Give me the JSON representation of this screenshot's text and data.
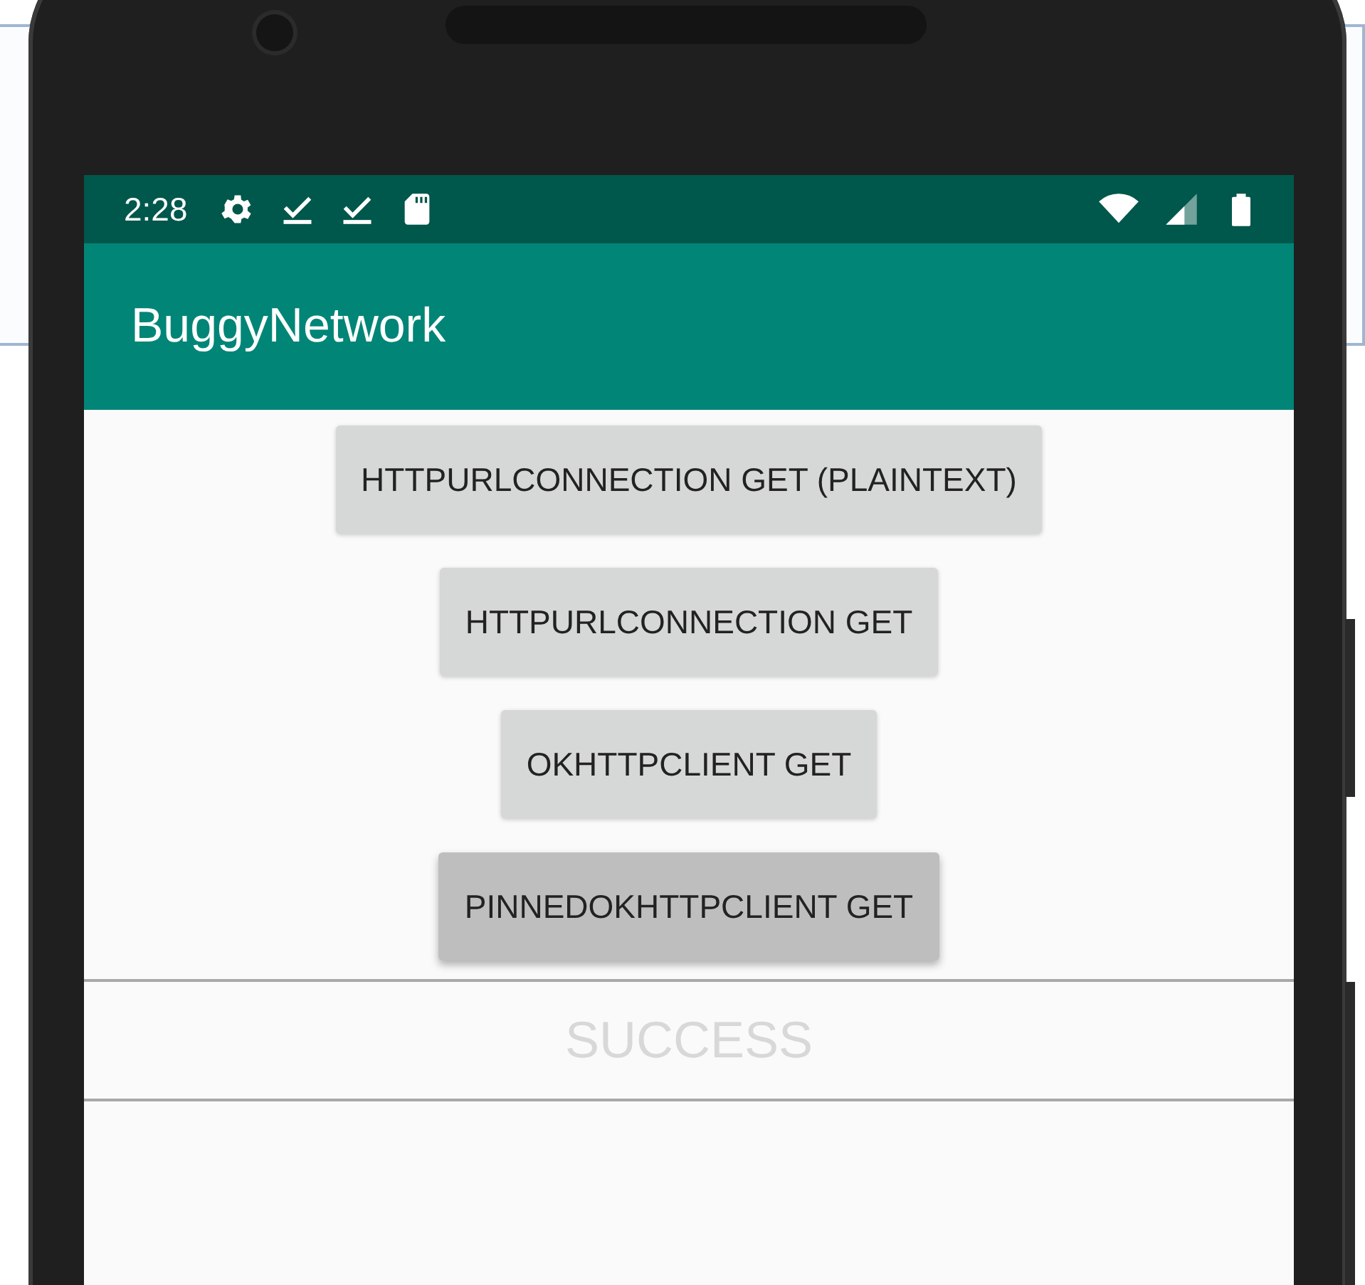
{
  "status_bar": {
    "time": "2:28"
  },
  "app_bar": {
    "title": "BuggyNetwork"
  },
  "buttons": [
    {
      "label": "HTTPURLCONNECTION GET (PLAINTEXT)",
      "pressed": false
    },
    {
      "label": "HTTPURLCONNECTION GET",
      "pressed": false
    },
    {
      "label": "OKHTTPCLIENT GET",
      "pressed": false
    },
    {
      "label": "PINNEDOKHTTPCLIENT GET",
      "pressed": true
    }
  ],
  "result": {
    "text": "SUCCESS"
  }
}
